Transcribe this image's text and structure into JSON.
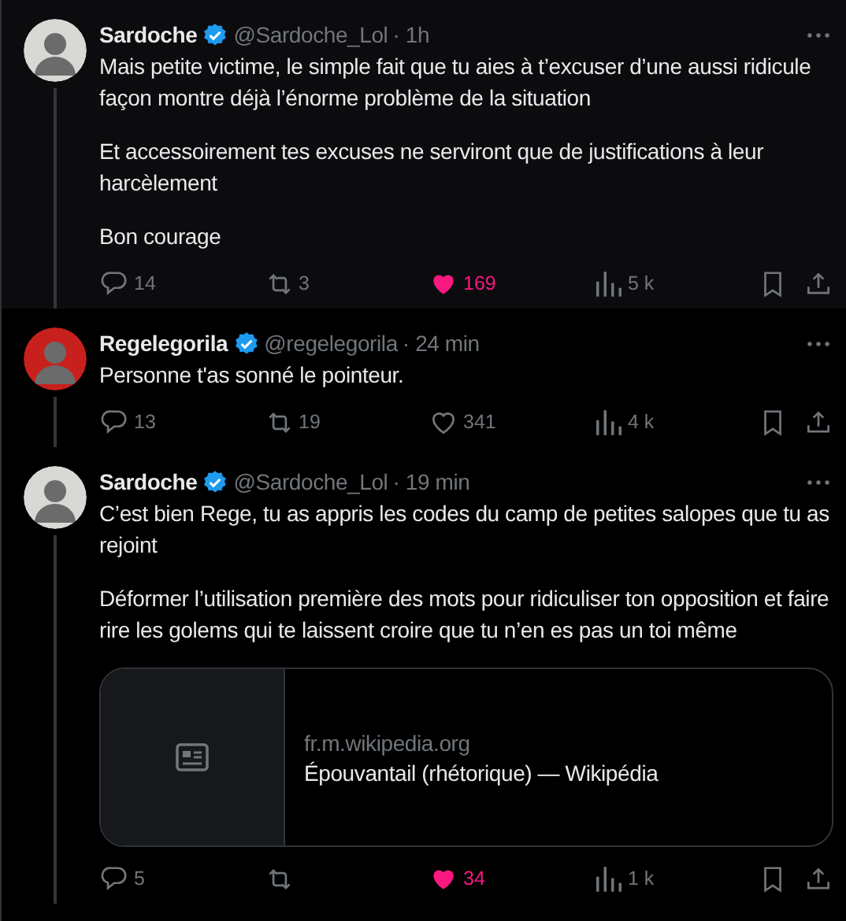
{
  "posts": [
    {
      "name": "Sardoche",
      "verified": true,
      "handle": "@Sardoche_Lol",
      "time": "· 1h",
      "highlighted": true,
      "color": "#d8d8d4",
      "paragraphs": [
        "Mais petite victime, le simple fait que tu aies à t’excuser d’une aussi ridicule façon montre déjà l’énorme problème de la situation",
        "Et accessoirement tes excuses ne serviront que de justifications à leur harcèlement",
        "Bon courage"
      ],
      "actions": {
        "replies": "14",
        "reposts": "3",
        "likes": "169",
        "liked": true,
        "views": "5 k"
      }
    },
    {
      "name": "Regelegorila",
      "verified": true,
      "handle": "@regelegorila",
      "time": "· 24 min",
      "highlighted": false,
      "color": "#c8201c",
      "paragraphs": [
        "Personne t'as sonné le pointeur."
      ],
      "actions": {
        "replies": "13",
        "reposts": "19",
        "likes": "341",
        "liked": false,
        "views": "4 k"
      }
    },
    {
      "name": "Sardoche",
      "verified": true,
      "handle": "@Sardoche_Lol",
      "time": "· 19 min",
      "highlighted": false,
      "color": "#d8d8d4",
      "paragraphs": [
        "C’est bien Rege, tu as appris les codes du camp de petites salopes que tu as rejoint",
        "Déformer l’utilisation première des mots pour ridiculiser ton opposition et faire rire les golems qui te laissent croire que tu n’en es pas un toi même"
      ],
      "link_card": {
        "domain": "fr.m.wikipedia.org",
        "title": "Épouvantail (rhétorique) — Wikipédia"
      },
      "actions": {
        "replies": "5",
        "likes": "34",
        "liked": true,
        "views": "1 k"
      }
    }
  ]
}
